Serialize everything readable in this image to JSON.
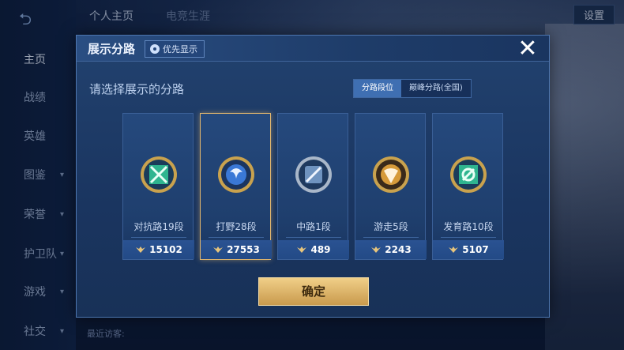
{
  "background": {
    "top_tabs": [
      "个人主页",
      "电竞生涯"
    ],
    "settings_label": "设置",
    "nav_items": [
      {
        "label": "主页",
        "expandable": false,
        "active": true
      },
      {
        "label": "战绩",
        "expandable": false,
        "active": false
      },
      {
        "label": "英雄",
        "expandable": false,
        "active": false
      },
      {
        "label": "图鉴",
        "expandable": true,
        "active": false
      },
      {
        "label": "荣誉",
        "expandable": true,
        "active": false
      },
      {
        "label": "护卫队",
        "expandable": true,
        "active": false
      },
      {
        "label": "游戏",
        "expandable": true,
        "active": false
      },
      {
        "label": "社交",
        "expandable": true,
        "active": false
      }
    ],
    "recent_visitors_label": "最近访客:"
  },
  "modal": {
    "title": "展示分路",
    "priority_tag": "优先显示",
    "close_icon": "close-icon",
    "subtitle": "请选择展示的分路",
    "toggle": {
      "active": "分路段位",
      "inactive": "巅峰分路(全国)"
    },
    "lanes": [
      {
        "label": "对抗路19段",
        "points": "15102",
        "icon": "clash-lane-emblem",
        "color": "#2fb58f",
        "selected": false
      },
      {
        "label": "打野28段",
        "points": "27553",
        "icon": "jungle-emblem",
        "color": "#3a78d6",
        "selected": true
      },
      {
        "label": "中路1段",
        "points": "489",
        "icon": "mid-lane-emblem",
        "color": "#6f93bf",
        "selected": false
      },
      {
        "label": "游走5段",
        "points": "2243",
        "icon": "roam-emblem",
        "color": "#d69a3a",
        "selected": false
      },
      {
        "label": "发育路10段",
        "points": "5107",
        "icon": "farm-lane-emblem",
        "color": "#2fb58f",
        "selected": false
      }
    ],
    "confirm_label": "确定"
  },
  "colors": {
    "accent_gold": "#e2b66d",
    "panel": "#1f3f6e"
  }
}
